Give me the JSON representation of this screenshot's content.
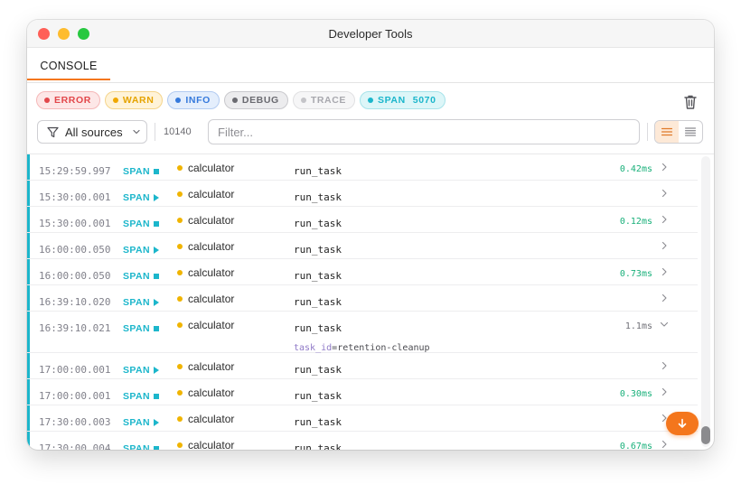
{
  "window": {
    "title": "Developer Tools"
  },
  "tabs": {
    "console": "CONSOLE"
  },
  "filters": {
    "error": "ERROR",
    "warn": "WARN",
    "info": "INFO",
    "debug": "DEBUG",
    "trace": "TRACE",
    "span": "SPAN",
    "span_count": "5070"
  },
  "toolbar": {
    "sources_label": "All sources",
    "entry_count": "10140",
    "filter_placeholder": "Filter..."
  },
  "rows": [
    {
      "time": "15:29:59.997",
      "level": "SPAN",
      "marker": "end",
      "source": "calculator",
      "message": "run_task",
      "duration": "0.42ms"
    },
    {
      "time": "15:30:00.001",
      "level": "SPAN",
      "marker": "start",
      "source": "calculator",
      "message": "run_task",
      "duration": ""
    },
    {
      "time": "15:30:00.001",
      "level": "SPAN",
      "marker": "end",
      "source": "calculator",
      "message": "run_task",
      "duration": "0.12ms"
    },
    {
      "time": "16:00:00.050",
      "level": "SPAN",
      "marker": "start",
      "source": "calculator",
      "message": "run_task",
      "duration": ""
    },
    {
      "time": "16:00:00.050",
      "level": "SPAN",
      "marker": "end",
      "source": "calculator",
      "message": "run_task",
      "duration": "0.73ms"
    },
    {
      "time": "16:39:10.020",
      "level": "SPAN",
      "marker": "start",
      "source": "calculator",
      "message": "run_task",
      "duration": ""
    },
    {
      "time": "16:39:10.021",
      "level": "SPAN",
      "marker": "end",
      "source": "calculator",
      "message": "run_task",
      "duration": "1.1ms",
      "expanded": true,
      "meta_key": "task_id",
      "meta_value": "retention-cleanup"
    },
    {
      "time": "17:00:00.001",
      "level": "SPAN",
      "marker": "start",
      "source": "calculator",
      "message": "run_task",
      "duration": ""
    },
    {
      "time": "17:00:00.001",
      "level": "SPAN",
      "marker": "end",
      "source": "calculator",
      "message": "run_task",
      "duration": "0.30ms"
    },
    {
      "time": "17:30:00.003",
      "level": "SPAN",
      "marker": "start",
      "source": "calculator",
      "message": "run_task",
      "duration": ""
    },
    {
      "time": "17:30:00.004",
      "level": "SPAN",
      "marker": "end",
      "source": "calculator",
      "message": "run_task",
      "duration": "0.67ms"
    }
  ],
  "icons": {
    "trash": "trash-icon",
    "filter": "filter-icon",
    "scroll_bottom": "arrow-down-icon",
    "list_view": "lines-icon",
    "compact_view": "compact-lines-icon"
  },
  "colors": {
    "accent": "#f4761c",
    "span": "#1cb6cb",
    "duration_fast": "#19b07a",
    "source_dot": "#f0b400"
  }
}
